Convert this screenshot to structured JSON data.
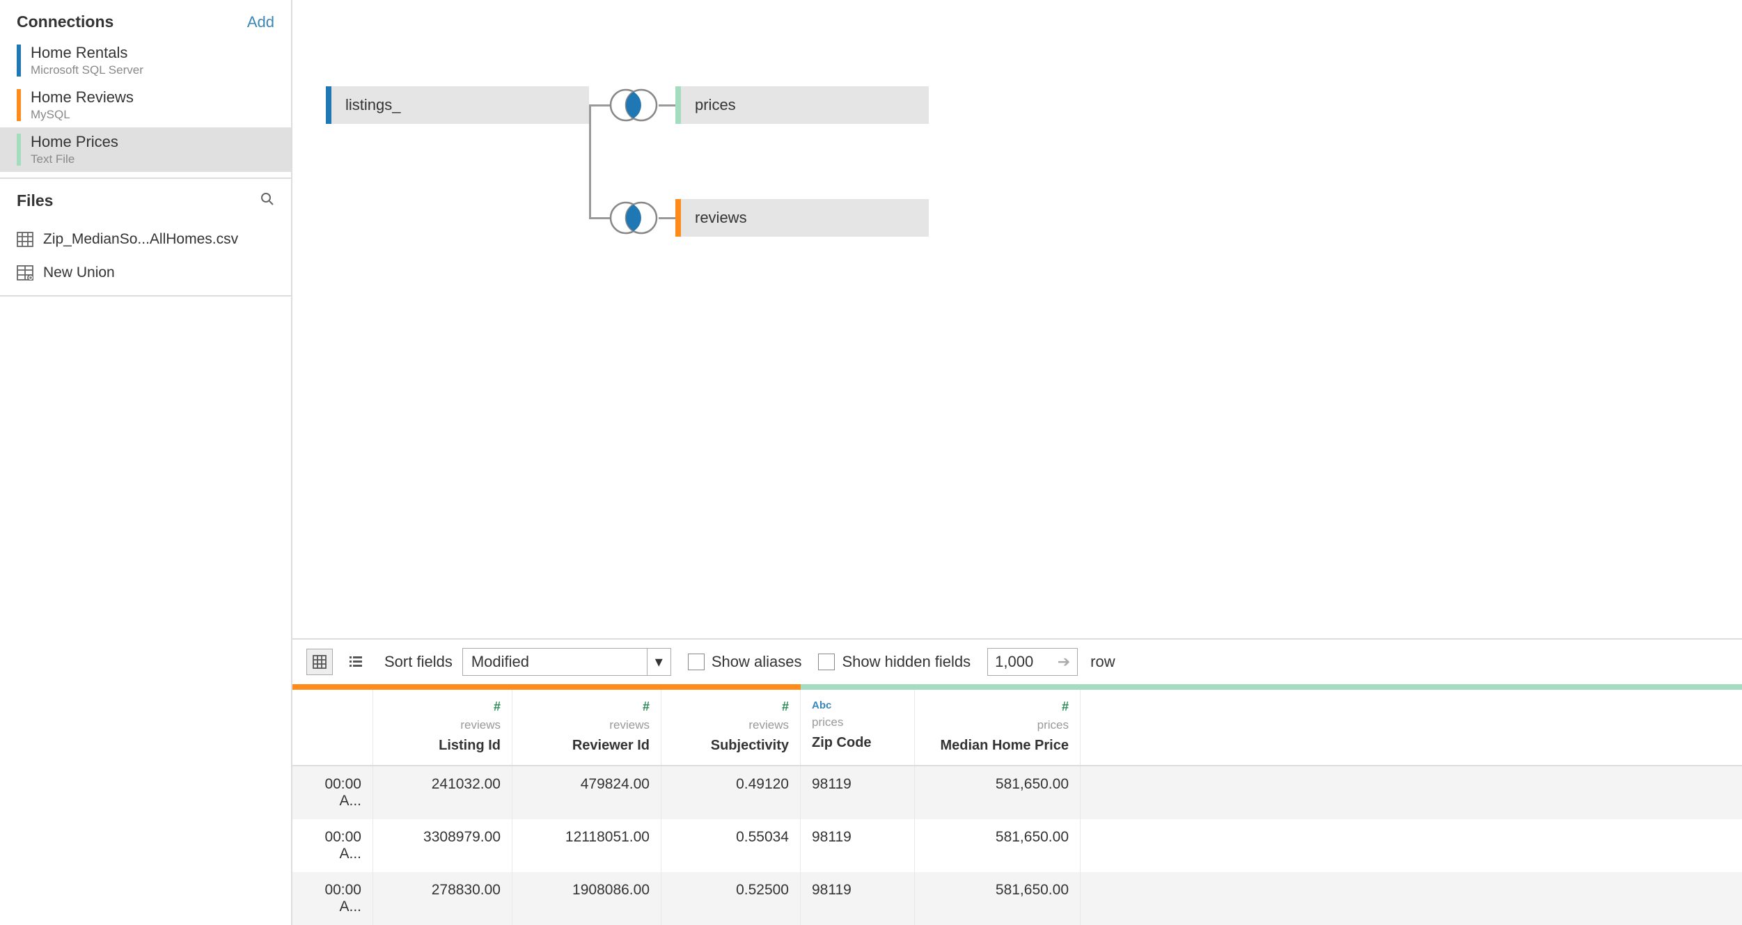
{
  "sidebar": {
    "connections_title": "Connections",
    "add_label": "Add",
    "connections": [
      {
        "name": "Home Rentals",
        "sub": "Microsoft SQL Server",
        "color": "blue",
        "selected": false
      },
      {
        "name": "Home Reviews",
        "sub": "MySQL",
        "color": "orange",
        "selected": false
      },
      {
        "name": "Home Prices",
        "sub": "Text File",
        "color": "green",
        "selected": true
      }
    ],
    "files_title": "Files",
    "files": [
      {
        "name": "Zip_MedianSo...AllHomes.csv"
      }
    ],
    "new_union": "New Union"
  },
  "canvas": {
    "nodes": {
      "listings": "listings_",
      "prices": "prices",
      "reviews": "reviews"
    }
  },
  "toolbar": {
    "sort_label": "Sort fields",
    "sort_value": "Modified",
    "show_aliases": "Show aliases",
    "show_hidden": "Show hidden fields",
    "rows_value": "1,000",
    "rows_suffix": "row"
  },
  "grid": {
    "columns": [
      {
        "type": "#",
        "type_class": "green",
        "source": "reviews",
        "name": "Listing Id",
        "kind": "num"
      },
      {
        "type": "#",
        "type_class": "green",
        "source": "reviews",
        "name": "Reviewer Id",
        "kind": "num wide"
      },
      {
        "type": "#",
        "type_class": "green",
        "source": "reviews",
        "name": "Subjectivity",
        "kind": "num"
      },
      {
        "type": "Abc",
        "type_class": "abc",
        "source": "prices",
        "name": "Zip Code",
        "kind": "zip"
      },
      {
        "type": "#",
        "type_class": "green",
        "source": "prices",
        "name": "Median Home Price",
        "kind": "price"
      }
    ],
    "rows": [
      {
        "time": "00:00 A...",
        "listing": "241032.00",
        "reviewer": "479824.00",
        "subj": "0.49120",
        "zip": "98119",
        "price": "581,650.00"
      },
      {
        "time": "00:00 A...",
        "listing": "3308979.00",
        "reviewer": "12118051.00",
        "subj": "0.55034",
        "zip": "98119",
        "price": "581,650.00"
      },
      {
        "time": "00:00 A...",
        "listing": "278830.00",
        "reviewer": "1908086.00",
        "subj": "0.52500",
        "zip": "98119",
        "price": "581,650.00"
      }
    ]
  }
}
